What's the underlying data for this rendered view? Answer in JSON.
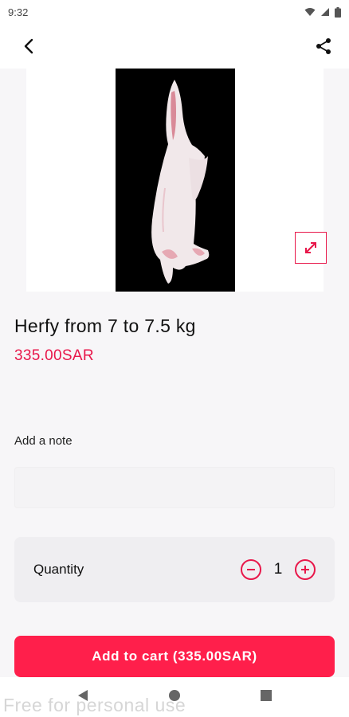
{
  "status_bar": {
    "time": "9:32"
  },
  "icons": {
    "back": "arrow-back-icon",
    "share": "share-icon",
    "expand": "expand-icon",
    "minus": "minus-circle-icon",
    "plus": "plus-circle-icon",
    "nav_back": "triangle-back-icon",
    "nav_home": "circle-home-icon",
    "nav_recent": "square-recents-icon"
  },
  "product": {
    "title": "Herfy from 7 to 7.5 kg",
    "price": "335.00SAR"
  },
  "note": {
    "label": "Add a note",
    "placeholder": ""
  },
  "quantity": {
    "label": "Quantity",
    "value": "1"
  },
  "cart": {
    "button_label": "Add to cart (335.00SAR)"
  },
  "watermark": "Free for personal use",
  "colors": {
    "accent": "#e8174a",
    "button": "#ff1f4b"
  }
}
